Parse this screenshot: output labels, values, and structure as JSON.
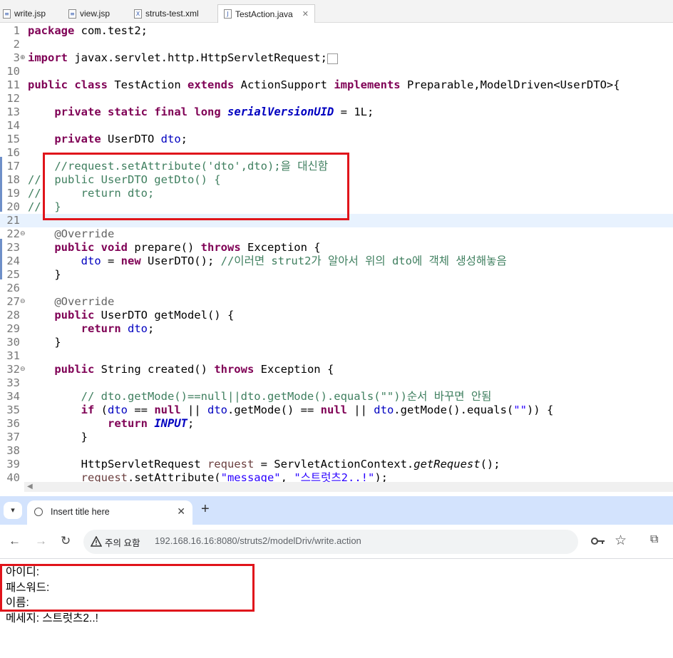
{
  "editor_tabs": [
    {
      "label": "write.jsp",
      "icon": "jsp-file-icon"
    },
    {
      "label": "view.jsp",
      "icon": "jsp-file-icon"
    },
    {
      "label": "struts-test.xml",
      "icon": "xml-file-icon"
    },
    {
      "label": "TestAction.java",
      "icon": "java-file-icon",
      "active": true
    }
  ],
  "code_lines": [
    {
      "n": "1",
      "html": "<span class='kw'>package</span> com.test2;"
    },
    {
      "n": "2",
      "html": ""
    },
    {
      "n": "3",
      "fold": "⊕",
      "html": "<span class='kw'>import</span> javax.servlet.http.HttpServletRequest;<span style='border:1px solid #999;font-size:11px;'>&nbsp;&nbsp;</span>"
    },
    {
      "n": "10",
      "html": ""
    },
    {
      "n": "11",
      "html": "<span class='kw'>public</span> <span class='kw'>class</span> TestAction <span class='kw'>extends</span> ActionSupport <span class='kw'>implements</span> Preparable,ModelDriven&lt;UserDTO&gt;{"
    },
    {
      "n": "12",
      "html": ""
    },
    {
      "n": "13",
      "html": "    <span class='kw'>private</span> <span class='kw'>static</span> <span class='kw'>final</span> <span class='kw'>long</span> <span class='sfld'>serialVersionUID</span> = 1L;"
    },
    {
      "n": "14",
      "html": ""
    },
    {
      "n": "15",
      "html": "    <span class='kw'>private</span> UserDTO <span class='fld'>dto</span>;"
    },
    {
      "n": "16",
      "html": ""
    },
    {
      "n": "17",
      "html": "<span class='cm'>    //request.setAttribute('dto',dto);을 대신함</span>"
    },
    {
      "n": "18",
      "html": "<span class='cm'>//  public UserDTO getDto() {</span>"
    },
    {
      "n": "19",
      "html": "<span class='cm'>//      return dto;</span>"
    },
    {
      "n": "20",
      "html": "<span class='cm'>//  }</span>"
    },
    {
      "n": "21",
      "html": "",
      "current": true
    },
    {
      "n": "22",
      "fold": "⊖",
      "html": "    <span class='ann'>@Override</span>"
    },
    {
      "n": "23",
      "html": "    <span class='kw'>public</span> <span class='kw'>void</span> prepare() <span class='kw'>throws</span> Exception {"
    },
    {
      "n": "24",
      "html": "        <span class='fld'>dto</span> = <span class='kw'>new</span> UserDTO(); <span class='cm'>//이러면 strut2가 알아서 위의 dto에 객체 생성해놓음</span>"
    },
    {
      "n": "25",
      "html": "    }"
    },
    {
      "n": "26",
      "html": ""
    },
    {
      "n": "27",
      "fold": "⊖",
      "html": "    <span class='ann'>@Override</span>"
    },
    {
      "n": "28",
      "html": "    <span class='kw'>public</span> UserDTO getModel() {"
    },
    {
      "n": "29",
      "html": "        <span class='kw'>return</span> <span class='fld'>dto</span>;"
    },
    {
      "n": "30",
      "html": "    }"
    },
    {
      "n": "31",
      "html": ""
    },
    {
      "n": "32",
      "fold": "⊖",
      "html": "    <span class='kw'>public</span> String created() <span class='kw'>throws</span> Exception {"
    },
    {
      "n": "33",
      "html": ""
    },
    {
      "n": "34",
      "html": "<span class='cm'>        // dto.getMode()==null||dto.getMode().equals(\"\"))순서 바꾸면 안됨</span>"
    },
    {
      "n": "35",
      "html": "        <span class='kw'>if</span> (<span class='fld'>dto</span> == <span class='kw'>null</span> || <span class='fld'>dto</span>.getMode() == <span class='kw'>null</span> || <span class='fld'>dto</span>.getMode().equals(<span class='str'>\"\"</span>)) {"
    },
    {
      "n": "36",
      "html": "            <span class='kw'>return</span> <span class='sfld'>INPUT</span>;"
    },
    {
      "n": "37",
      "html": "        }"
    },
    {
      "n": "38",
      "html": ""
    },
    {
      "n": "39",
      "html": "        HttpServletRequest <span style='color:#6a3e3e'>request</span> = ServletActionContext.<span class='it'>getRequest</span>();"
    },
    {
      "n": "40",
      "html": "        <span style='color:#6a3e3e'>request</span>.setAttribute(<span class='str'>\"message\"</span>, <span class='str'>\"스트럿츠2..!\"</span>);"
    }
  ],
  "browser": {
    "tab_title": "Insert title here",
    "security_label": "주의 요함",
    "url": "192.168.16.16:8080/struts2/modelDriv/write.action"
  },
  "page": {
    "lines": [
      "아이디:",
      "패스워드:",
      "이름:",
      "메세지: 스트럿츠2..!"
    ]
  }
}
